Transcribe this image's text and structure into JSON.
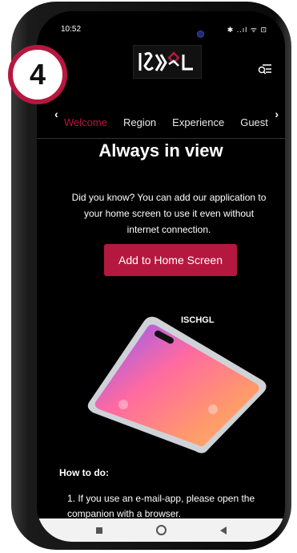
{
  "badge": {
    "label": "4"
  },
  "status": {
    "time": "10:52",
    "icons": "✱ ..ıl ᯤ ⊡"
  },
  "header": {
    "logo": "ISCHGL"
  },
  "tabs": [
    {
      "label": "Welcome"
    },
    {
      "label": "Region"
    },
    {
      "label": "Experience"
    },
    {
      "label": "Guest"
    }
  ],
  "nav_arrows": {
    "left": "‹",
    "right": "›"
  },
  "main": {
    "title": "Always in view",
    "description": "Did you know? You can add our application to your home screen to use it even without internet connection.",
    "cta_label": "Add to Home Screen",
    "illustration_logo": "ISCHGL",
    "howto_title": "How to do:",
    "step1": "1. If you use an e-mail-app, please open the companion with a browser."
  },
  "colors": {
    "accent": "#b5183f",
    "background": "#000000",
    "text": "#ffffff"
  }
}
